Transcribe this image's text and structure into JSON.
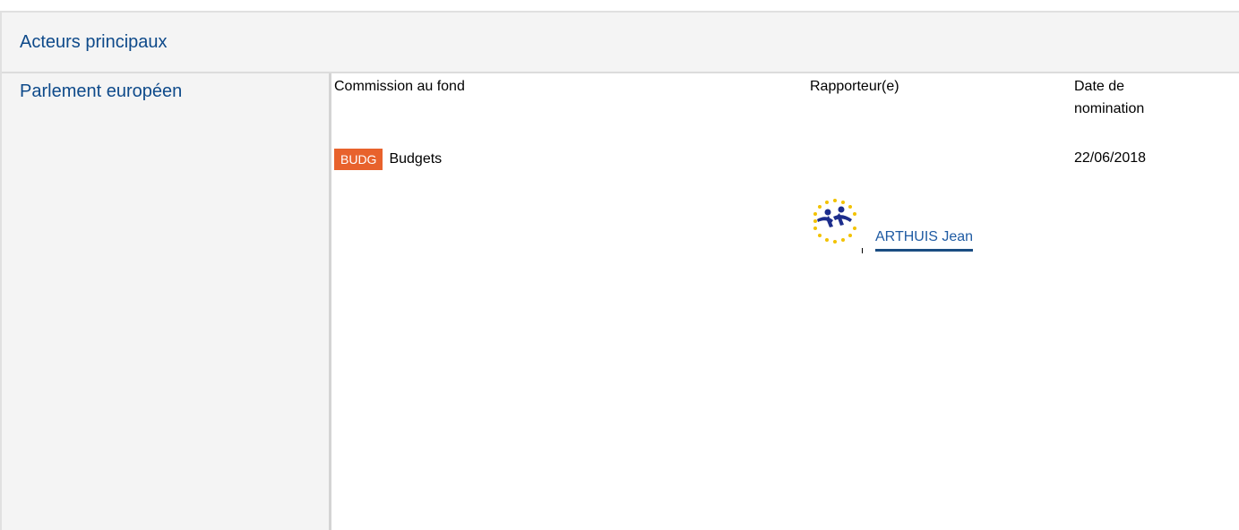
{
  "section": {
    "title": "Acteurs principaux"
  },
  "institution": {
    "name": "Parlement européen"
  },
  "columns": {
    "committee": "Commission au fond",
    "rapporteur": "Rapporteur(e)",
    "appointment_date": "Date de nomination"
  },
  "committee": {
    "code": "BUDG",
    "name": "Budgets",
    "badge_color": "#e8622c"
  },
  "appointment": {
    "date": "22/06/2018"
  },
  "rapporteur": {
    "name": "ARTHUIS Jean",
    "party_logo_icon": "ep-political-group-logo-icon"
  },
  "colors": {
    "accent_text": "#0e4a8a",
    "link": "#1f5ba3",
    "panel_background": "#f4f4f4"
  }
}
